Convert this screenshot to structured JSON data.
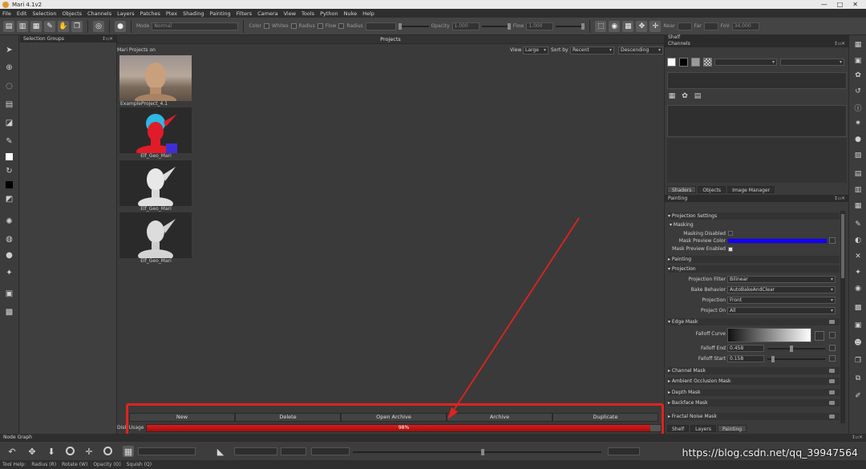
{
  "window": {
    "title": "Mari 4.1v2",
    "controls": [
      "—",
      "□",
      "✕"
    ]
  },
  "menu": [
    "File",
    "Edit",
    "Selection",
    "Objects",
    "Channels",
    "Layers",
    "Patches",
    "Ptex",
    "Shading",
    "Painting",
    "Filters",
    "Camera",
    "View",
    "Tools",
    "Python",
    "Nuke",
    "Help"
  ],
  "toolbar": {
    "mode_label": "Mode",
    "mode_value": "Normal",
    "color_label": "Color",
    "check_labels": [
      "Whites",
      "Radius",
      "Flow",
      "Radius"
    ],
    "opacity_label": "Opacity",
    "opacity_value": "1.000",
    "flow_label": "Flow",
    "flow_value": "1.000",
    "near_label": "Near",
    "far_label": "Far",
    "fov_label": "FoV",
    "fov_value": "34.000"
  },
  "selection_groups": {
    "title": "Selection Groups"
  },
  "projects": {
    "title": "Projects",
    "header_label": "Mari Projects on",
    "view_label": "View",
    "view_value": "Large",
    "sort_label": "Sort by",
    "sort_value": "Recent",
    "order_value": "Descending",
    "items": [
      {
        "name": "ExampleProject_4.1"
      },
      {
        "name": "Elf_Geo_Mari"
      },
      {
        "name": "Elf_Geo_Mari"
      },
      {
        "name": "Elf_Geo_Mari"
      }
    ],
    "buttons": [
      "New",
      "Delete",
      "Open Archive",
      "Archive",
      "Duplicate"
    ],
    "disk_usage_label": "Disk Usage",
    "disk_usage_fraction": 0.98,
    "disk_usage_text": "98%"
  },
  "right_panel": {
    "top_header": "Shelf",
    "channels_title": "Channels",
    "lower_tabs": [
      "Shaders",
      "Objects",
      "Image Manager"
    ],
    "painting_header": "Painting",
    "sections": {
      "projection_settings": "Projection Settings",
      "masking": "Masking",
      "masking_disabled": "Masking Disabled",
      "mask_preview_color": "Mask Preview Color",
      "mask_preview_color_hex": "#1400ff",
      "mask_preview_enabled": "Mask Preview Enabled",
      "painting": "Painting",
      "projection": "Projection",
      "projection_filter_label": "Projection Filter",
      "projection_filter_value": "Bilinear",
      "bake_behavior_label": "Bake Behavior",
      "bake_behavior_value": "AutoBakeAndClear",
      "projection_label": "Projection",
      "projection_value": "Front",
      "project_on_label": "Project On",
      "project_on_value": "All",
      "edge_mask": "Edge Mask",
      "falloff_curve_label": "Falloff Curve",
      "falloff_end_label": "Falloff End",
      "falloff_end_value": "0.458",
      "falloff_start_label": "Falloff Start",
      "falloff_start_value": "0.158",
      "channel_mask": "Channel Mask",
      "ambient_occlusion_mask": "Ambient Occlusion Mask",
      "depth_mask": "Depth Mask",
      "backface_mask": "Backface Mask",
      "fractal_noise_mask": "Fractal Noise Mask"
    },
    "bottom_tabs": [
      "Shelf",
      "Layers",
      "Painting"
    ]
  },
  "bottom": {
    "node_graph": "Node Graph",
    "status": [
      "Tool Help:",
      "Radius (R)",
      "Rotate (W)",
      "Opacity (O)",
      "Squish (Q)"
    ]
  },
  "watermark": "https://blog.csdn.net/qq_39947564",
  "colors": {
    "highlight": "#e0231f",
    "disk_fill": "#c31616",
    "mask_color": "#1400ff"
  }
}
